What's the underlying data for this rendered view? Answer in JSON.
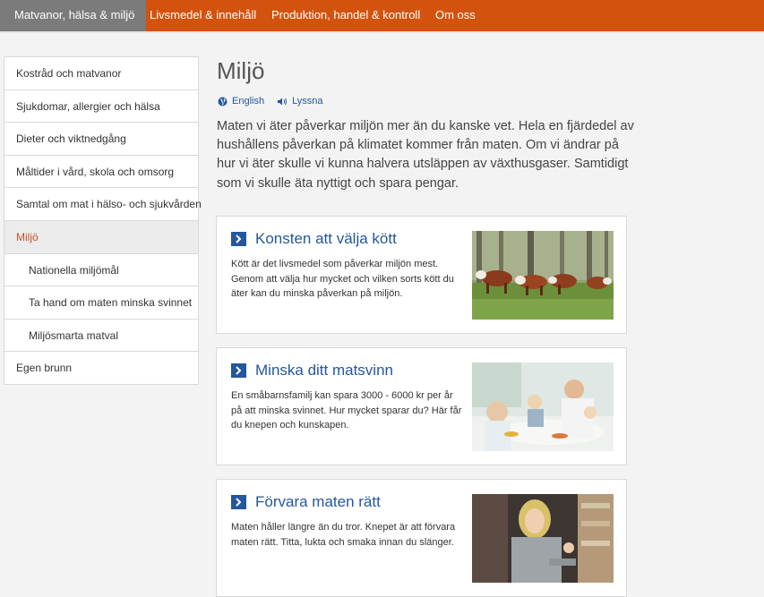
{
  "topnav": {
    "items": [
      {
        "label": "Matvanor, hälsa & miljö"
      },
      {
        "label": "Livsmedel & innehåll"
      },
      {
        "label": "Produktion, handel & kontroll"
      },
      {
        "label": "Om oss"
      }
    ]
  },
  "sidebar": {
    "items": [
      {
        "label": "Kostråd och matvanor"
      },
      {
        "label": "Sjukdomar, allergier och hälsa"
      },
      {
        "label": "Dieter och viktnedgång"
      },
      {
        "label": "Måltider i vård, skola och omsorg"
      },
      {
        "label": "Samtal om mat i hälso- och sjukvården"
      },
      {
        "label": "Miljö"
      },
      {
        "label": "Nationella miljömål"
      },
      {
        "label": "Ta hand om maten minska svinnet"
      },
      {
        "label": "Miljösmarta matval"
      },
      {
        "label": "Egen brunn"
      }
    ]
  },
  "main": {
    "title": "Miljö",
    "lang_english": "English",
    "lang_listen": "Lyssna",
    "intro": "Maten vi äter påverkar miljön mer än du kanske vet. Hela en fjärdedel av hushållens påverkan på klimatet kommer från maten. Om vi ändrar på hur vi äter skulle vi kunna halvera utsläppen av växthusgaser. Samtidigt som vi skulle äta nyttigt och spara pengar.",
    "cards": [
      {
        "title": "Konsten att välja kött",
        "desc": "Kött är det livsmedel som påverkar miljön mest. Genom att välja hur mycket och vilken sorts kött du äter kan du minska påverkan på miljön."
      },
      {
        "title": "Minska ditt matsvinn",
        "desc": "En småbarnsfamilj kan spara 3000 - 6000 kr per år på att minska svinnet. Hur mycket sparar du? Här får du knepen och kunskapen."
      },
      {
        "title": "Förvara maten rätt",
        "desc": "Maten håller längre än du tror. Knepet är att förvara maten rätt. Titta, lukta och smaka innan du slänger."
      }
    ]
  },
  "colors": {
    "accent": "#d3530e",
    "link": "#24579c",
    "active_nav": "#7b7b7b",
    "active_sidebar_text": "#c0512f"
  },
  "icons": [
    "globe-icon",
    "speaker-icon",
    "chevron-right-icon"
  ]
}
